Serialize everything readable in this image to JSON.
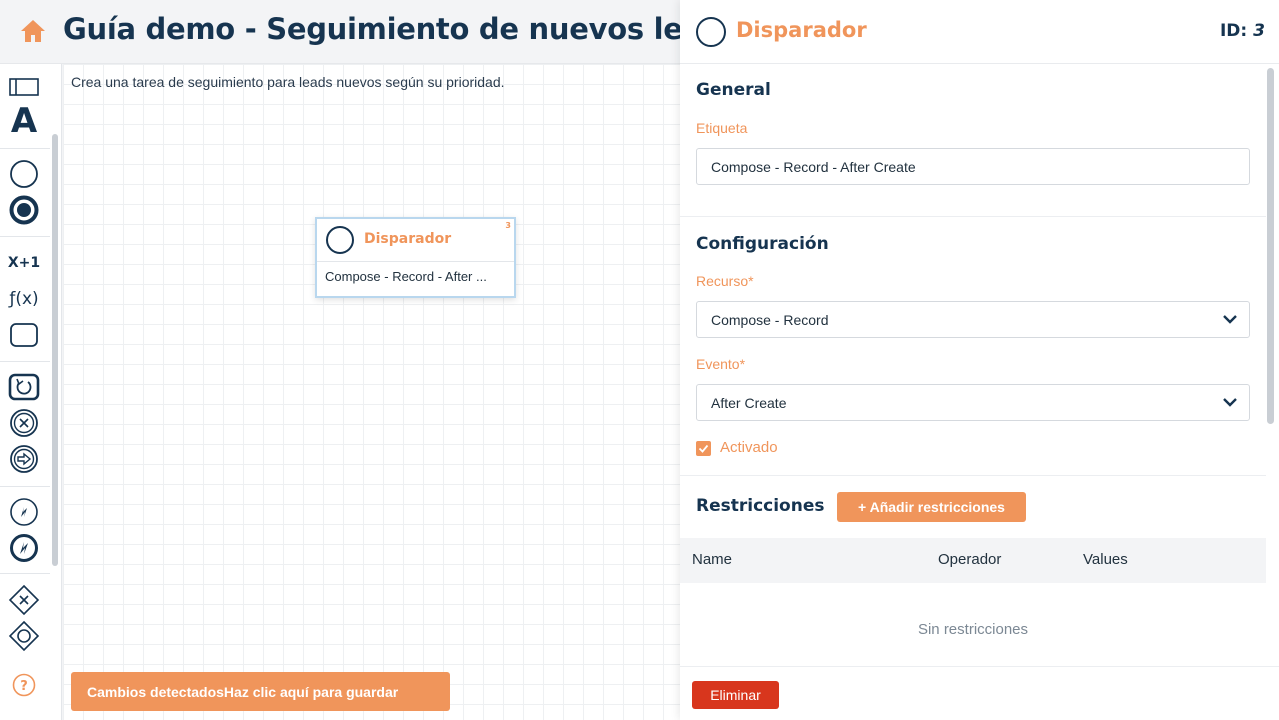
{
  "header": {
    "title": "Guía demo - Seguimiento de nuevos leads"
  },
  "canvas": {
    "description": "Crea una tarea de seguimiento para leads nuevos según su prioridad.",
    "node": {
      "title": "Disparador",
      "id": "3",
      "body": "Compose - Record - After ..."
    },
    "save_button": "Cambios detectadosHaz clic aquí para guardar"
  },
  "toolbar": {
    "items": [
      "swimlane-icon",
      "text-icon",
      "start-event-icon",
      "end-event-icon",
      "expression-icon",
      "function-icon",
      "task-icon",
      "loop-icon",
      "error-icon",
      "exit-icon",
      "prompt-icon",
      "trigger-icon",
      "exclusive-gateway-icon",
      "inclusive-gateway-icon",
      "help-icon"
    ],
    "expr_label": "X+1",
    "func_label": "ƒ(x)",
    "text_label": "A"
  },
  "panel": {
    "title": "Disparador",
    "id_label": "ID:",
    "id_value": "3",
    "general": {
      "title": "General",
      "label_label": "Etiqueta",
      "label_value": "Compose - Record - After Create"
    },
    "config": {
      "title": "Configuración",
      "resource_label": "Recurso*",
      "resource_value": "Compose - Record",
      "event_label": "Evento*",
      "event_value": "After Create",
      "enabled_label": "Activado",
      "enabled": true
    },
    "restrictions": {
      "title": "Restricciones",
      "add_button": "+ Añadir restricciones",
      "columns": [
        "Name",
        "Operador",
        "Values"
      ],
      "empty": "Sin restricciones"
    },
    "delete_button": "Eliminar"
  },
  "colors": {
    "accent": "#f0955b",
    "primary": "#163450",
    "danger": "#d8361d"
  }
}
